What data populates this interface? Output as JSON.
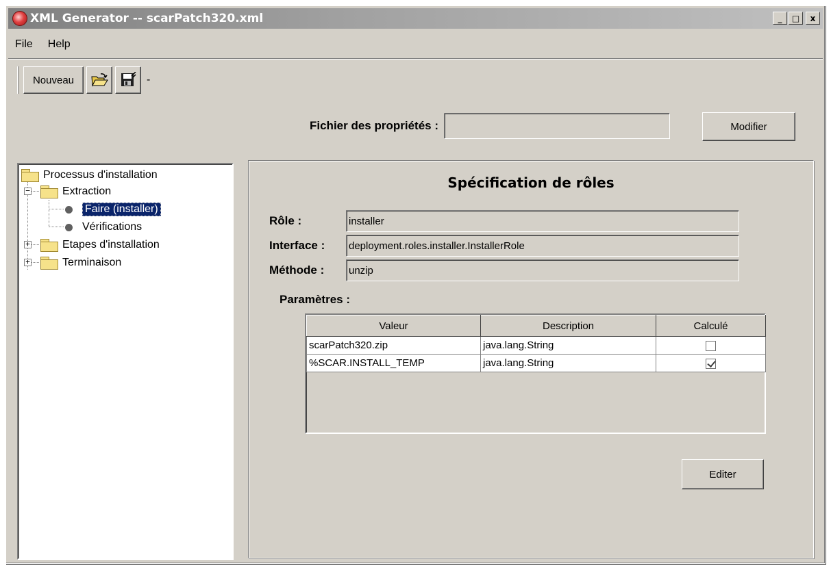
{
  "window": {
    "title": "XML Generator -- scarPatch320.xml",
    "controls": {
      "minimize": "_",
      "maximize": "□",
      "close": "x"
    }
  },
  "menubar": {
    "items": [
      "File",
      "Help"
    ]
  },
  "toolbar": {
    "new_label": "Nouveau",
    "open_icon": "open-folder-icon",
    "save_icon": "save-disk-icon",
    "trailing_text": "-"
  },
  "properties": {
    "label": "Fichier des propriétés :",
    "value": "",
    "modify_label": "Modifier"
  },
  "tree": {
    "root": "Processus d'installation",
    "extraction": "Extraction",
    "faire": "Faire (installer)",
    "verifications": "Vérifications",
    "etapes": "Etapes d'installation",
    "terminaison": "Terminaison"
  },
  "role_panel": {
    "title": "Spécification de rôles",
    "role_label": "Rôle :",
    "role_value": "installer",
    "interface_label": "Interface :",
    "interface_value": "deployment.roles.installer.InstallerRole",
    "method_label": "Méthode :",
    "method_value": "unzip",
    "params_label": "Paramètres :",
    "columns": [
      "Valeur",
      "Description",
      "Calculé"
    ],
    "rows": [
      {
        "valeur": "scarPatch320.zip",
        "description": "java.lang.String",
        "calcule": false
      },
      {
        "valeur": "%SCAR.INSTALL_TEMP",
        "description": "java.lang.String",
        "calcule": true
      }
    ],
    "edit_label": "Editer"
  },
  "colors": {
    "face": "#d4d0c8",
    "selection": "#0a246a",
    "folder": "#f6e28a"
  }
}
